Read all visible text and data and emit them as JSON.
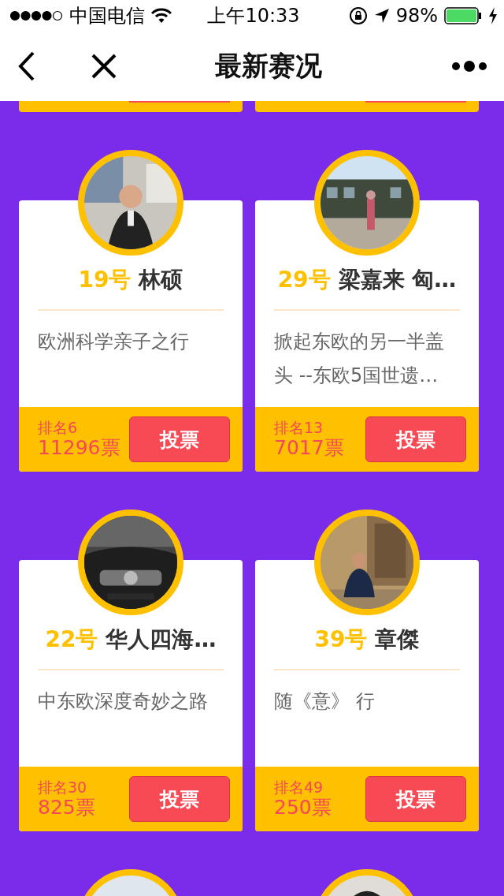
{
  "status_bar": {
    "carrier": "中国电信",
    "time": "上午10:33",
    "battery": "98%"
  },
  "nav": {
    "title": "最新赛况"
  },
  "cards": [
    {
      "kind": "footer_edge"
    },
    {
      "kind": "footer_edge"
    },
    {
      "kind": "entry",
      "number": "19号",
      "name": "林硕",
      "title": "欧洲科学亲子之行",
      "rank": "排名6",
      "votes": "11296票",
      "button": "投票"
    },
    {
      "kind": "entry",
      "number": "29号",
      "name": "梁嘉来 匈…",
      "title": "掀起东欧的另一半盖头 --东欧5国世遗…",
      "rank": "排名13",
      "votes": "7017票",
      "button": "投票"
    },
    {
      "kind": "entry",
      "number": "22号",
      "name": "华人四海…",
      "title": "中东欧深度奇妙之路",
      "rank": "排名30",
      "votes": "825票",
      "button": "投票"
    },
    {
      "kind": "entry",
      "number": "39号",
      "name": "章傑",
      "title": "随《意》 行",
      "rank": "排名49",
      "votes": "250票",
      "button": "投票"
    },
    {
      "kind": "avatar_edge"
    },
    {
      "kind": "avatar_edge"
    }
  ]
}
